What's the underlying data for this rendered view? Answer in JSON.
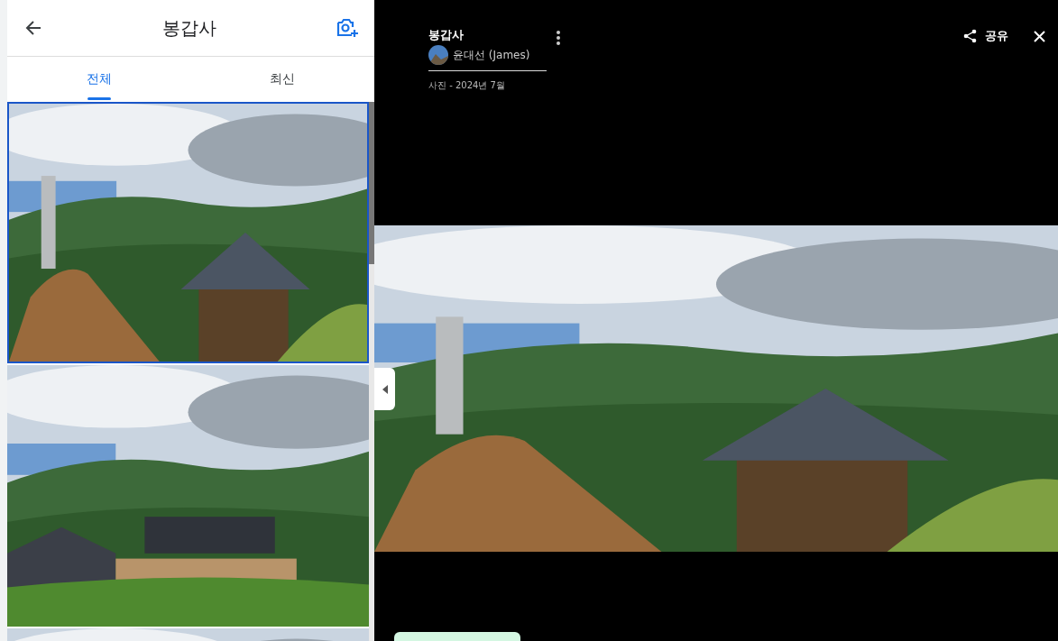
{
  "album": {
    "title": "봉갑사"
  },
  "tabs": [
    {
      "label": "전체",
      "selected": true
    },
    {
      "label": "최신",
      "selected": false
    }
  ],
  "photos": [
    {
      "selected": true
    },
    {
      "selected": false
    },
    {
      "selected": false
    }
  ],
  "viewer": {
    "title": "봉갑사",
    "owner": "윤대선 (James)",
    "meta": "사진 - 2024년 7월",
    "share": "공유"
  }
}
